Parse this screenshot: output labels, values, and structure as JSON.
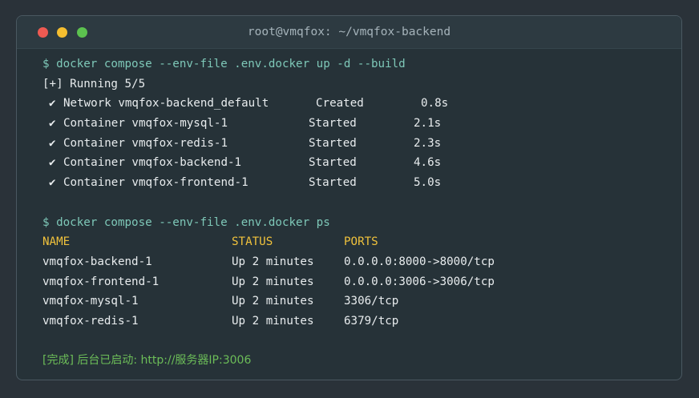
{
  "window": {
    "title": "root@vmqfox: ~/vmqfox-backend"
  },
  "terminal": {
    "cmd_up": "$ docker compose --env-file .env.docker up -d --build",
    "running": "[+] Running 5/5",
    "check_glyph": "✔",
    "progress": [
      {
        "name": "Network vmqfox-backend_default",
        "status": "Created",
        "time": "0.8s"
      },
      {
        "name": "Container vmqfox-mysql-1",
        "status": "Started",
        "time": "2.1s"
      },
      {
        "name": "Container vmqfox-redis-1",
        "status": "Started",
        "time": "2.3s"
      },
      {
        "name": "Container vmqfox-backend-1",
        "status": "Started",
        "time": "4.6s"
      },
      {
        "name": "Container vmqfox-frontend-1",
        "status": "Started",
        "time": "5.0s"
      }
    ],
    "cmd_ps": "$ docker compose --env-file .env.docker ps",
    "ps_headers": {
      "name": "NAME",
      "status": "STATUS",
      "ports": "PORTS"
    },
    "ps_rows": [
      {
        "name": "vmqfox-backend-1",
        "status": "Up 2 minutes",
        "ports": "0.0.0.0:8000->8000/tcp"
      },
      {
        "name": "vmqfox-frontend-1",
        "status": "Up 2 minutes",
        "ports": "0.0.0.0:3006->3006/tcp"
      },
      {
        "name": "vmqfox-mysql-1",
        "status": "Up 2 minutes",
        "ports": "3306/tcp"
      },
      {
        "name": "vmqfox-redis-1",
        "status": "Up 2 minutes",
        "ports": "6379/tcp"
      }
    ],
    "done_message": "[完成] 后台已启动: http://服务器IP:3006"
  },
  "colors": {
    "background": "#2a3239",
    "terminal_bg": "#263238",
    "command": "#7ec8b8",
    "header": "#f0c23c",
    "success": "#6cbd58",
    "close_button": "#ee5a52",
    "minimize_button": "#f5be2f",
    "maximize_button": "#5cc24f"
  }
}
